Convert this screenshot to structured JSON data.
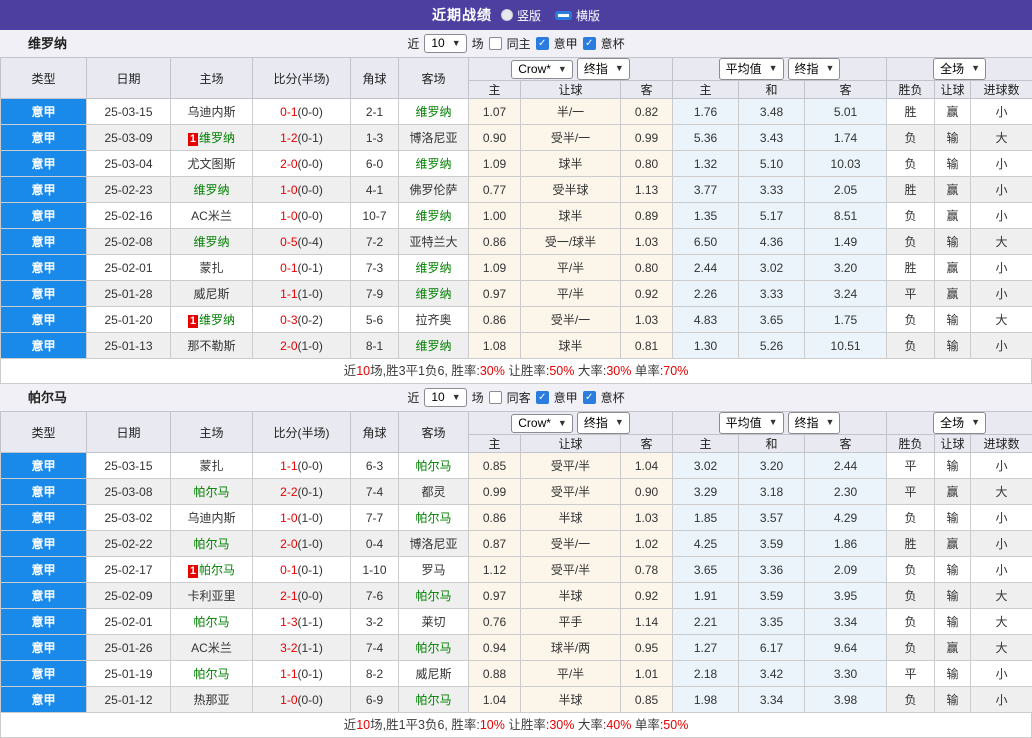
{
  "title_bar": {
    "title": "近期战绩",
    "radio_vertical": "竖版",
    "radio_horizontal": "横版"
  },
  "colors": {
    "header_purple": "#4c3fa0",
    "league_blue": "#1a8aea",
    "focus_team_green": "#008000",
    "win_red": "#e60000",
    "lose_blue": "#2828cc",
    "draw_green": "#009900",
    "cream_col": "#fcf5ea",
    "pale_blue_col": "#eaf4fa"
  },
  "sections": [
    {
      "team": "维罗纳",
      "filter": {
        "near_label": "近",
        "count_value": "10",
        "matches_label": "场",
        "same_label": "同主",
        "same_checked": false,
        "league_label": "意甲",
        "league_checked": true,
        "cup_label": "意杯",
        "cup_checked": true
      },
      "header": {
        "cols": [
          "类型",
          "日期",
          "主场",
          "比分(半场)",
          "角球",
          "客场"
        ],
        "group1_dd1": "Crow*",
        "group1_dd2": "终指",
        "group2_dd1": "平均值",
        "group2_dd2": "终指",
        "group3_dd": "全场",
        "sub": [
          "主",
          "让球",
          "客",
          "主",
          "和",
          "客",
          "胜负",
          "让球",
          "进球数"
        ]
      },
      "rows": [
        {
          "league": "意甲",
          "date": "25-03-15",
          "home": "乌迪内斯",
          "score": "0-1",
          "half": "(0-0)",
          "corner": "2-1",
          "away": "维罗纳",
          "odds_home": "1.07",
          "handicap": "半/一",
          "odds_away": "0.82",
          "avg_home": "1.76",
          "avg_draw": "3.48",
          "avg_away": "5.01",
          "result": "胜",
          "handicap_result": "赢",
          "goals": "小"
        },
        {
          "league": "意甲",
          "date": "25-03-09",
          "home": "维罗纳",
          "home_badge": "1",
          "score": "1-2",
          "half": "(0-1)",
          "corner": "1-3",
          "away": "博洛尼亚",
          "odds_home": "0.90",
          "handicap": "受半/一",
          "odds_away": "0.99",
          "avg_home": "5.36",
          "avg_draw": "3.43",
          "avg_away": "1.74",
          "result": "负",
          "handicap_result": "输",
          "goals": "大"
        },
        {
          "league": "意甲",
          "date": "25-03-04",
          "home": "尤文图斯",
          "score": "2-0",
          "half": "(0-0)",
          "corner": "6-0",
          "away": "维罗纳",
          "odds_home": "1.09",
          "handicap": "球半",
          "odds_away": "0.80",
          "avg_home": "1.32",
          "avg_draw": "5.10",
          "avg_away": "10.03",
          "result": "负",
          "handicap_result": "输",
          "goals": "小"
        },
        {
          "league": "意甲",
          "date": "25-02-23",
          "home": "维罗纳",
          "score": "1-0",
          "half": "(0-0)",
          "corner": "4-1",
          "away": "佛罗伦萨",
          "odds_home": "0.77",
          "handicap": "受半球",
          "odds_away": "1.13",
          "avg_home": "3.77",
          "avg_draw": "3.33",
          "avg_away": "2.05",
          "result": "胜",
          "handicap_result": "赢",
          "goals": "小"
        },
        {
          "league": "意甲",
          "date": "25-02-16",
          "home": "AC米兰",
          "score": "1-0",
          "half": "(0-0)",
          "corner": "10-7",
          "away": "维罗纳",
          "odds_home": "1.00",
          "handicap": "球半",
          "odds_away": "0.89",
          "avg_home": "1.35",
          "avg_draw": "5.17",
          "avg_away": "8.51",
          "result": "负",
          "handicap_result": "赢",
          "goals": "小"
        },
        {
          "league": "意甲",
          "date": "25-02-08",
          "home": "维罗纳",
          "score": "0-5",
          "half": "(0-4)",
          "corner": "7-2",
          "away": "亚特兰大",
          "odds_home": "0.86",
          "handicap": "受一/球半",
          "odds_away": "1.03",
          "avg_home": "6.50",
          "avg_draw": "4.36",
          "avg_away": "1.49",
          "result": "负",
          "handicap_result": "输",
          "goals": "大"
        },
        {
          "league": "意甲",
          "date": "25-02-01",
          "home": "蒙扎",
          "score": "0-1",
          "half": "(0-1)",
          "corner": "7-3",
          "away": "维罗纳",
          "odds_home": "1.09",
          "handicap": "平/半",
          "odds_away": "0.80",
          "avg_home": "2.44",
          "avg_draw": "3.02",
          "avg_away": "3.20",
          "result": "胜",
          "handicap_result": "赢",
          "goals": "小"
        },
        {
          "league": "意甲",
          "date": "25-01-28",
          "home": "威尼斯",
          "score": "1-1",
          "half": "(1-0)",
          "corner": "7-9",
          "away": "维罗纳",
          "odds_home": "0.97",
          "handicap": "平/半",
          "odds_away": "0.92",
          "avg_home": "2.26",
          "avg_draw": "3.33",
          "avg_away": "3.24",
          "result": "平",
          "handicap_result": "赢",
          "goals": "小"
        },
        {
          "league": "意甲",
          "date": "25-01-20",
          "home": "维罗纳",
          "home_badge": "1",
          "score": "0-3",
          "half": "(0-2)",
          "corner": "5-6",
          "away": "拉齐奥",
          "odds_home": "0.86",
          "handicap": "受半/一",
          "odds_away": "1.03",
          "avg_home": "4.83",
          "avg_draw": "3.65",
          "avg_away": "1.75",
          "result": "负",
          "handicap_result": "输",
          "goals": "大"
        },
        {
          "league": "意甲",
          "date": "25-01-13",
          "home": "那不勒斯",
          "score": "2-0",
          "half": "(1-0)",
          "corner": "8-1",
          "away": "维罗纳",
          "odds_home": "1.08",
          "handicap": "球半",
          "odds_away": "0.81",
          "avg_home": "1.30",
          "avg_draw": "5.26",
          "avg_away": "10.51",
          "result": "负",
          "handicap_result": "输",
          "goals": "小"
        }
      ],
      "summary": [
        {
          "t": "近"
        },
        {
          "t": "10",
          "red": true
        },
        {
          "t": "场,胜3平1负6, 胜率:"
        },
        {
          "t": "30%",
          "red": true
        },
        {
          "t": " 让胜率:"
        },
        {
          "t": "50%",
          "red": true
        },
        {
          "t": " 大率:"
        },
        {
          "t": "30%",
          "red": true
        },
        {
          "t": " 单率:"
        },
        {
          "t": "70%",
          "red": true
        }
      ]
    },
    {
      "team": "帕尔马",
      "filter": {
        "near_label": "近",
        "count_value": "10",
        "matches_label": "场",
        "same_label": "同客",
        "same_checked": false,
        "league_label": "意甲",
        "league_checked": true,
        "cup_label": "意杯",
        "cup_checked": true
      },
      "header": {
        "cols": [
          "类型",
          "日期",
          "主场",
          "比分(半场)",
          "角球",
          "客场"
        ],
        "group1_dd1": "Crow*",
        "group1_dd2": "终指",
        "group2_dd1": "平均值",
        "group2_dd2": "终指",
        "group3_dd": "全场",
        "sub": [
          "主",
          "让球",
          "客",
          "主",
          "和",
          "客",
          "胜负",
          "让球",
          "进球数"
        ]
      },
      "rows": [
        {
          "league": "意甲",
          "date": "25-03-15",
          "home": "蒙扎",
          "score": "1-1",
          "half": "(0-0)",
          "corner": "6-3",
          "away": "帕尔马",
          "odds_home": "0.85",
          "handicap": "受平/半",
          "odds_away": "1.04",
          "avg_home": "3.02",
          "avg_draw": "3.20",
          "avg_away": "2.44",
          "result": "平",
          "handicap_result": "输",
          "goals": "小"
        },
        {
          "league": "意甲",
          "date": "25-03-08",
          "home": "帕尔马",
          "score": "2-2",
          "half": "(0-1)",
          "corner": "7-4",
          "away": "都灵",
          "odds_home": "0.99",
          "handicap": "受平/半",
          "odds_away": "0.90",
          "avg_home": "3.29",
          "avg_draw": "3.18",
          "avg_away": "2.30",
          "result": "平",
          "handicap_result": "赢",
          "goals": "大"
        },
        {
          "league": "意甲",
          "date": "25-03-02",
          "home": "乌迪内斯",
          "score": "1-0",
          "half": "(1-0)",
          "corner": "7-7",
          "away": "帕尔马",
          "odds_home": "0.86",
          "handicap": "半球",
          "odds_away": "1.03",
          "avg_home": "1.85",
          "avg_draw": "3.57",
          "avg_away": "4.29",
          "result": "负",
          "handicap_result": "输",
          "goals": "小"
        },
        {
          "league": "意甲",
          "date": "25-02-22",
          "home": "帕尔马",
          "score": "2-0",
          "half": "(1-0)",
          "corner": "0-4",
          "away": "博洛尼亚",
          "odds_home": "0.87",
          "handicap": "受半/一",
          "odds_away": "1.02",
          "avg_home": "4.25",
          "avg_draw": "3.59",
          "avg_away": "1.86",
          "result": "胜",
          "handicap_result": "赢",
          "goals": "小"
        },
        {
          "league": "意甲",
          "date": "25-02-17",
          "home": "帕尔马",
          "home_badge": "1",
          "score": "0-1",
          "half": "(0-1)",
          "corner": "1-10",
          "away": "罗马",
          "odds_home": "1.12",
          "handicap": "受平/半",
          "odds_away": "0.78",
          "avg_home": "3.65",
          "avg_draw": "3.36",
          "avg_away": "2.09",
          "result": "负",
          "handicap_result": "输",
          "goals": "小"
        },
        {
          "league": "意甲",
          "date": "25-02-09",
          "home": "卡利亚里",
          "score": "2-1",
          "half": "(0-0)",
          "corner": "7-6",
          "away": "帕尔马",
          "odds_home": "0.97",
          "handicap": "半球",
          "odds_away": "0.92",
          "avg_home": "1.91",
          "avg_draw": "3.59",
          "avg_away": "3.95",
          "result": "负",
          "handicap_result": "输",
          "goals": "大"
        },
        {
          "league": "意甲",
          "date": "25-02-01",
          "home": "帕尔马",
          "score": "1-3",
          "half": "(1-1)",
          "corner": "3-2",
          "away": "莱切",
          "odds_home": "0.76",
          "handicap": "平手",
          "odds_away": "1.14",
          "avg_home": "2.21",
          "avg_draw": "3.35",
          "avg_away": "3.34",
          "result": "负",
          "handicap_result": "输",
          "goals": "大"
        },
        {
          "league": "意甲",
          "date": "25-01-26",
          "home": "AC米兰",
          "score": "3-2",
          "half": "(1-1)",
          "corner": "7-4",
          "away": "帕尔马",
          "odds_home": "0.94",
          "handicap": "球半/两",
          "odds_away": "0.95",
          "avg_home": "1.27",
          "avg_draw": "6.17",
          "avg_away": "9.64",
          "result": "负",
          "handicap_result": "赢",
          "goals": "大"
        },
        {
          "league": "意甲",
          "date": "25-01-19",
          "home": "帕尔马",
          "score": "1-1",
          "half": "(0-1)",
          "corner": "8-2",
          "away": "威尼斯",
          "odds_home": "0.88",
          "handicap": "平/半",
          "odds_away": "1.01",
          "avg_home": "2.18",
          "avg_draw": "3.42",
          "avg_away": "3.30",
          "result": "平",
          "handicap_result": "输",
          "goals": "小"
        },
        {
          "league": "意甲",
          "date": "25-01-12",
          "home": "热那亚",
          "score": "1-0",
          "half": "(0-0)",
          "corner": "6-9",
          "away": "帕尔马",
          "odds_home": "1.04",
          "handicap": "半球",
          "odds_away": "0.85",
          "avg_home": "1.98",
          "avg_draw": "3.34",
          "avg_away": "3.98",
          "result": "负",
          "handicap_result": "输",
          "goals": "小"
        }
      ],
      "summary": [
        {
          "t": "近"
        },
        {
          "t": "10",
          "red": true
        },
        {
          "t": "场,胜1平3负6, 胜率:"
        },
        {
          "t": "10%",
          "red": true
        },
        {
          "t": " 让胜率:"
        },
        {
          "t": "30%",
          "red": true
        },
        {
          "t": " 大率:"
        },
        {
          "t": "40%",
          "red": true
        },
        {
          "t": " 单率:"
        },
        {
          "t": "50%",
          "red": true
        }
      ]
    }
  ]
}
